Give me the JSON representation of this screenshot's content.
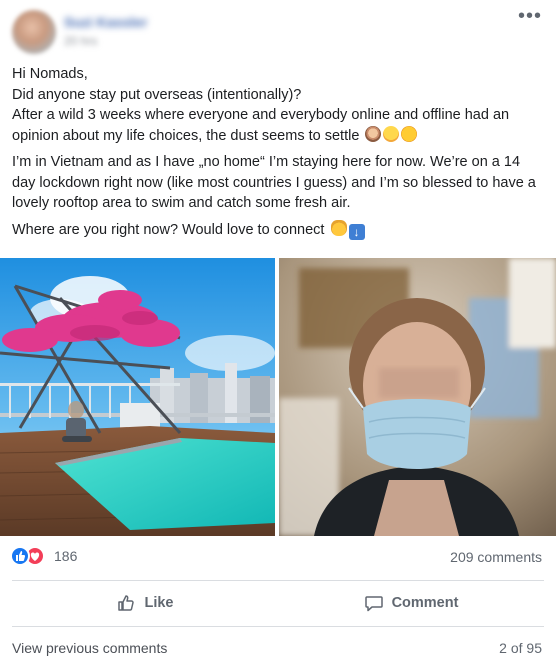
{
  "post": {
    "author_name": "Suzi Kassler",
    "time": "20 hrs",
    "more_icon": "more-dots-icon",
    "paragraphs": [
      "Hi Nomads,",
      "Did anyone stay put overseas (intentionally)?",
      "After a wild 3 weeks where everyone and everybody online and offline had an opinion about my life choices, the dust seems to settle",
      "I’m in Vietnam and as I have „no home“ I’m staying here for now. We’re on a 14 day lockdown right now (like most countries I guess) and I’m so blessed to have a lovely rooftop area to swim and catch some fresh air.",
      "Where are you right now? Would love to connect"
    ],
    "emojis_line3": [
      "woman-shrugging-emoji",
      "flushed-face-emoji",
      "rofl-emoji"
    ],
    "emojis_line5": [
      "waving-hand-emoji",
      "down-arrow-emoji"
    ],
    "photos": [
      "rooftop-pool-photo",
      "masked-selfie-photo"
    ]
  },
  "footer": {
    "reaction_icons": [
      "like-reaction-icon",
      "love-reaction-icon"
    ],
    "reaction_count": "186",
    "comment_count": "209 comments",
    "like_label": "Like",
    "comment_label": "Comment",
    "view_previous": "View previous comments",
    "pager": "2 of 95"
  },
  "colors": {
    "link_blue": "#4b4f56",
    "like_blue": "#1877f2",
    "love_red": "#f33e58",
    "muted": "#606770"
  }
}
